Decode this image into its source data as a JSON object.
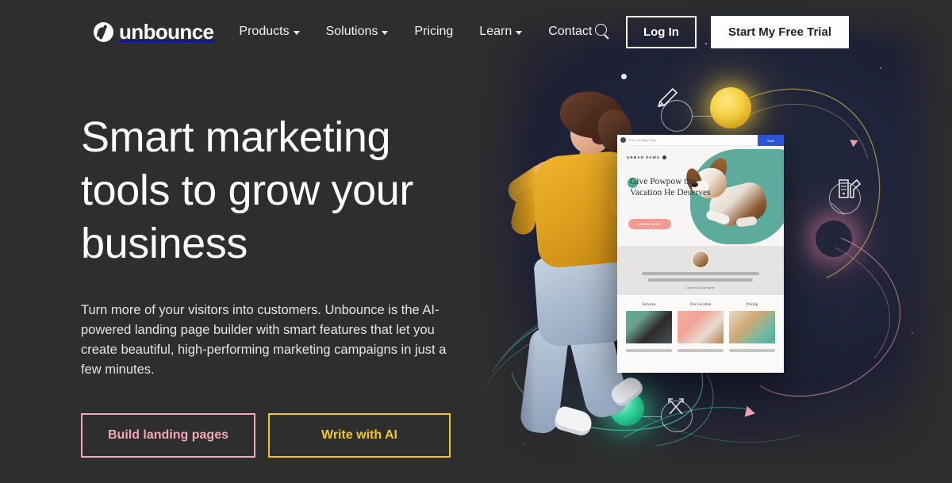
{
  "brand": {
    "name": "unbounce",
    "logo_icon": "unbounce-circle-logo"
  },
  "nav": {
    "links": [
      {
        "label": "Products",
        "has_dropdown": true
      },
      {
        "label": "Solutions",
        "has_dropdown": true
      },
      {
        "label": "Pricing",
        "has_dropdown": false
      },
      {
        "label": "Learn",
        "has_dropdown": true
      },
      {
        "label": "Contact",
        "has_dropdown": false
      }
    ],
    "search_icon": "search-icon",
    "login_label": "Log In",
    "trial_label": "Start My Free Trial"
  },
  "hero": {
    "headline": "Smart marketing tools to grow your business",
    "subcopy": "Turn more of your visitors into customers. Unbounce is the AI-powered landing page builder with smart features that let you create beautiful, high-performing marketing campaigns in just a few minutes.",
    "cta_primary": "Build landing pages",
    "cta_secondary": "Write with AI"
  },
  "mockup": {
    "browser_title": "Your Landing Page",
    "save_label": "Save",
    "brand": "URBAN PAWS",
    "headline": "Give Powpow the Vacation He Deserves",
    "button": "BOOK NOW",
    "caption": "Owner & Dog Name",
    "cards": [
      {
        "title": "Services"
      },
      {
        "title": "Our Location"
      },
      {
        "title": "Pricing"
      }
    ]
  },
  "decorations": {
    "icons": [
      {
        "name": "pen-tool-icon"
      },
      {
        "name": "color-palette-icon"
      },
      {
        "name": "crossing-arrows-icon"
      }
    ],
    "orbs": [
      {
        "name": "yellow-glow-orb",
        "color": "#f7cf3a"
      },
      {
        "name": "pink-glow-orb",
        "color": "#f58aa8"
      },
      {
        "name": "green-glow-orb",
        "color": "#35d9a0"
      }
    ]
  },
  "colors": {
    "background": "#2e2e2e",
    "accent_pink": "#f0a8b8",
    "accent_yellow": "#f5c518",
    "white": "#ffffff",
    "mockup_blue": "#2b57d6",
    "mockup_teal": "#5cab9c",
    "mockup_coral": "#f29a94"
  }
}
